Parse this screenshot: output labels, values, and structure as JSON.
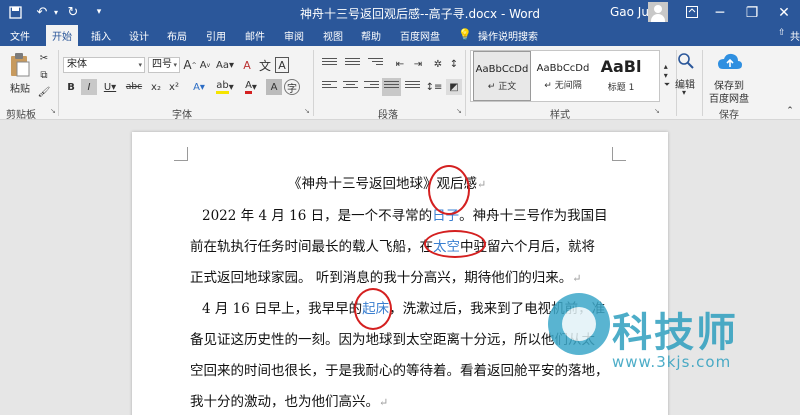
{
  "titlebar": {
    "doc_title": "神舟十三号返回观后感--高子寻.docx  -  Word",
    "user_name": "Gao Jun",
    "minimize": "─",
    "restore": "❐",
    "close": "✕"
  },
  "tabs": [
    "文件",
    "开始",
    "插入",
    "设计",
    "布局",
    "引用",
    "邮件",
    "审阅",
    "视图",
    "帮助",
    "百度网盘",
    "操作说明搜索"
  ],
  "share_label": "共享",
  "ribbon": {
    "groups": {
      "clipboard": "剪贴板",
      "font": "字体",
      "paragraph": "段落",
      "styles": "样式",
      "save": "保存"
    },
    "paste_label": "粘贴",
    "font_name": "宋体",
    "font_size": "四号",
    "font_buttons": [
      "A",
      "A",
      "Aa",
      "A",
      "B",
      "I",
      "U",
      "abc",
      "x₂",
      "x²",
      "A",
      "A",
      "A"
    ],
    "styles": [
      {
        "sample": "AaBbCcDd",
        "name": "↵ 正文"
      },
      {
        "sample": "AaBbCcDd",
        "name": "↵ 无间隔"
      },
      {
        "sample": "AaBl",
        "name": "标题 1"
      }
    ],
    "edit_label": "编辑",
    "baidu_save_line1": "保存到",
    "baidu_save_line2": "百度网盘"
  },
  "document": {
    "title": "《神舟十三号返回地球》观后感",
    "l2_a": "2022 年 4 月 16 日，是一个不寻常的",
    "l2_b": "日子",
    "l2_c": "。神舟十三号作为我国目",
    "l3_a": "前在轨执行任务时间最长的载人飞船，在",
    "l3_b": "太空",
    "l3_c": "中驻留六个月后，就将",
    "l4": "正式返回地球家园。  听到消息的我十分高兴，期待他们的归来。",
    "l5_a": "4 月 16 日早上，我早早的",
    "l5_b": "起床",
    "l5_c": "，洗漱过后，我来到了电视机前，准",
    "l6": "备见证这历史性的一刻。因为地球到太空距离十分远，所以他们从太",
    "l7": "空回来的时间也很长，于是我耐心的等待着。看着返回舱平安的落地，",
    "l8": "我十分的激动，也为他们高兴。",
    "para_mark": "↵"
  },
  "watermark": {
    "brand": "科技师",
    "url": "www.3kjs.com"
  }
}
